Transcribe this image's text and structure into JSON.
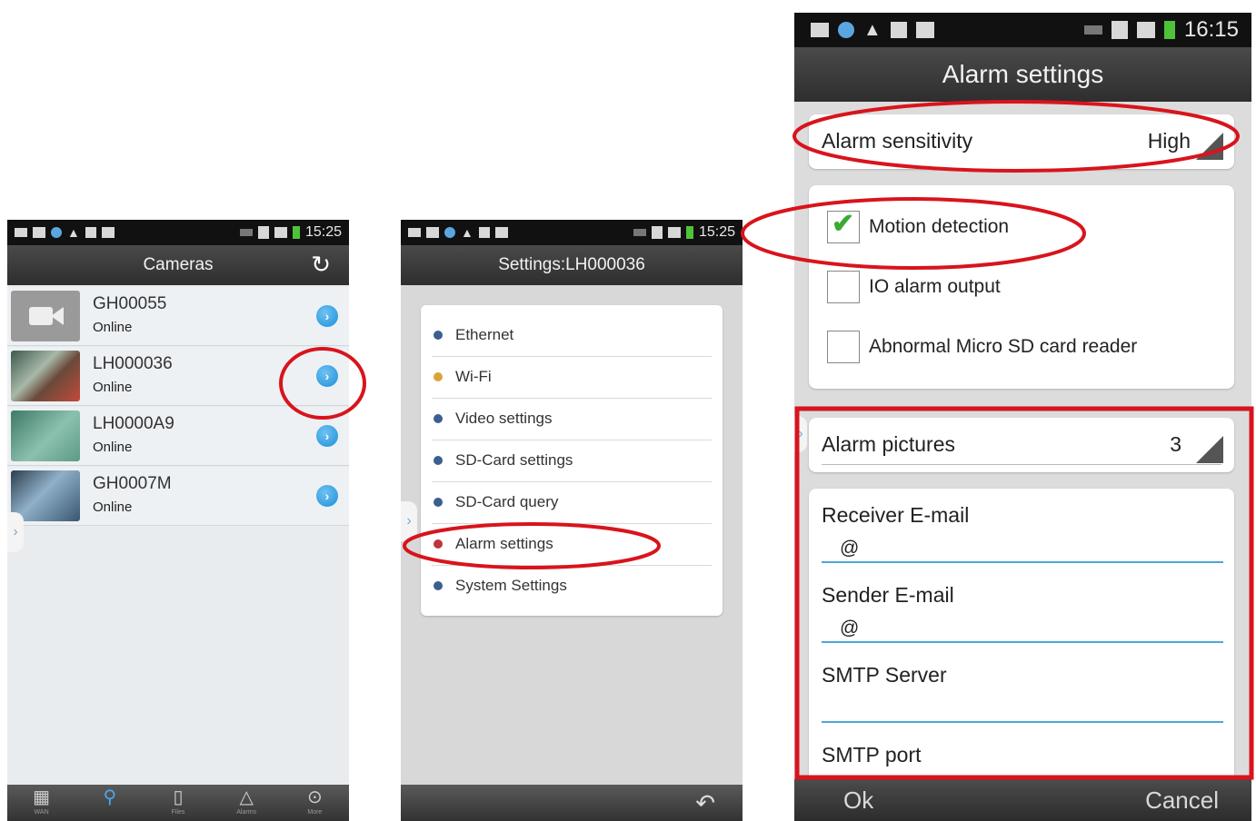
{
  "phone1": {
    "status_time": "15:25",
    "title": "Cameras",
    "refresh_icon": "refresh-icon",
    "cameras": [
      {
        "name": "GH00055",
        "status": "Online",
        "thumb_color": "#9a9a9a"
      },
      {
        "name": "LH000036",
        "status": "Online",
        "thumb_color": "#5e7f6f"
      },
      {
        "name": "LH0000A9",
        "status": "Online",
        "thumb_color": "#5c9a86"
      },
      {
        "name": "GH0007M",
        "status": "Online",
        "thumb_color": "#4e6e84"
      }
    ],
    "tabs": [
      {
        "label": "WAN",
        "icon": "qr-code-icon"
      },
      {
        "label": "",
        "icon": "search-icon"
      },
      {
        "label": "Files",
        "icon": "files-icon"
      },
      {
        "label": "Alarms",
        "icon": "alarm-icon"
      },
      {
        "label": "More",
        "icon": "more-icon"
      }
    ]
  },
  "phone2": {
    "status_time": "15:25",
    "title": "Settings:LH000036",
    "menu": [
      {
        "label": "Ethernet",
        "color": "#3b5f8f"
      },
      {
        "label": "Wi-Fi",
        "color": "#d9a53a"
      },
      {
        "label": "Video settings",
        "color": "#3b5f8f"
      },
      {
        "label": "SD-Card settings",
        "color": "#3b5f8f"
      },
      {
        "label": "SD-Card query",
        "color": "#3b5f8f"
      },
      {
        "label": "Alarm settings",
        "color": "#c0333a"
      },
      {
        "label": "System Settings",
        "color": "#3b5f8f"
      }
    ],
    "back_icon": "back-icon"
  },
  "phone3": {
    "status_time": "16:15",
    "title": "Alarm settings",
    "sensitivity": {
      "label": "Alarm sensitivity",
      "value": "High"
    },
    "options": [
      {
        "label": "Motion detection",
        "checked": true
      },
      {
        "label": "IO alarm output",
        "checked": false
      },
      {
        "label": "Abnormal Micro SD card reader",
        "checked": false
      }
    ],
    "pictures": {
      "label": "Alarm pictures",
      "value": "3"
    },
    "fields": [
      {
        "label": "Receiver E-mail",
        "value": "@"
      },
      {
        "label": "Sender E-mail",
        "value": "@"
      },
      {
        "label": "SMTP Server",
        "value": ""
      },
      {
        "label": "SMTP port",
        "value": ""
      }
    ],
    "ok_label": "Ok",
    "cancel_label": "Cancel"
  },
  "colors": {
    "annotation_red": "#d8141c",
    "accent_blue": "#1c8fd8"
  }
}
